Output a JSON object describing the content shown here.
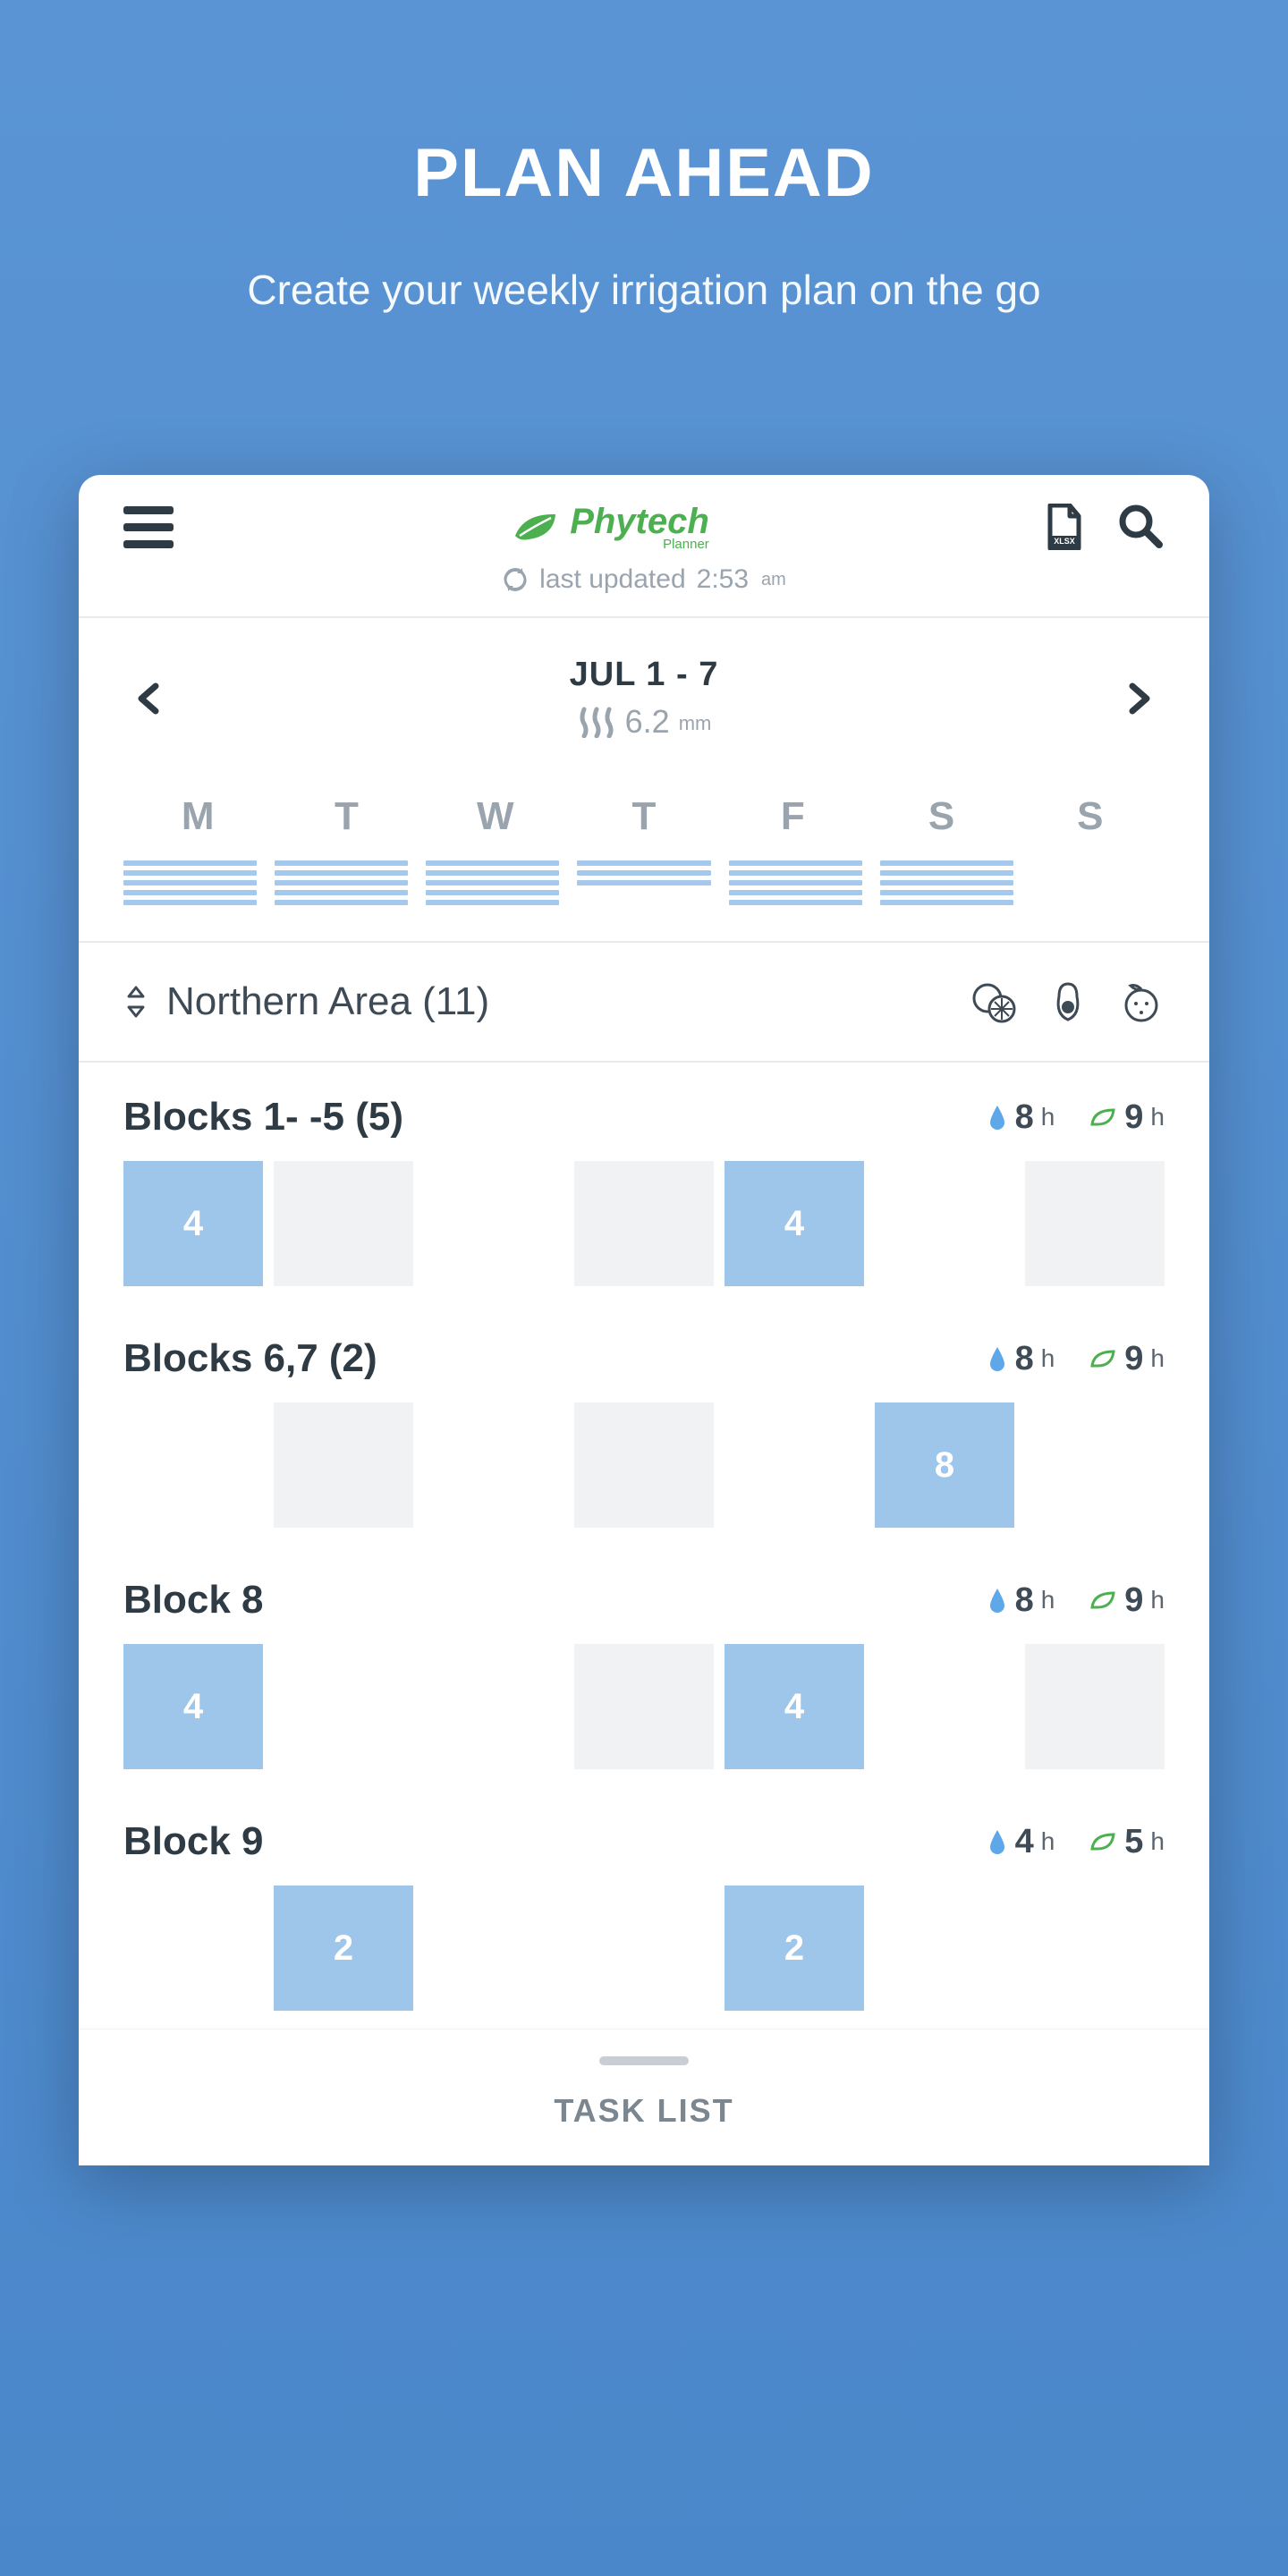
{
  "hero": {
    "title": "PLAN AHEAD",
    "subtitle": "Create your weekly irrigation plan on the go"
  },
  "app": {
    "brand": "Phytech",
    "brand_sub": "Planner",
    "last_updated_prefix": "last updated ",
    "last_updated_time": "2:53",
    "last_updated_ampm": "am",
    "xlsx_label": "XLSX"
  },
  "week": {
    "range": "JUL 1 - 7",
    "evap_value": "6.2",
    "evap_unit": "mm",
    "days": [
      "M",
      "T",
      "W",
      "T",
      "F",
      "S",
      "S"
    ]
  },
  "area": {
    "name": "Northern Area (11)",
    "crops": [
      "citrus",
      "avocado",
      "orange"
    ]
  },
  "blocks": [
    {
      "title": "Blocks 1- -5 (5)",
      "water_h": "8",
      "reco_h": "9",
      "cells": [
        {
          "type": "filled",
          "val": "4"
        },
        {
          "type": "empty"
        },
        {
          "type": "blank"
        },
        {
          "type": "empty"
        },
        {
          "type": "filled",
          "val": "4"
        },
        {
          "type": "blank"
        },
        {
          "type": "empty"
        }
      ]
    },
    {
      "title": "Blocks 6,7 (2)",
      "water_h": "8",
      "reco_h": "9",
      "cells": [
        {
          "type": "blank"
        },
        {
          "type": "empty"
        },
        {
          "type": "blank"
        },
        {
          "type": "empty"
        },
        {
          "type": "blank"
        },
        {
          "type": "filled",
          "val": "8"
        },
        {
          "type": "blank"
        }
      ]
    },
    {
      "title": "Block 8",
      "water_h": "8",
      "reco_h": "9",
      "cells": [
        {
          "type": "filled",
          "val": "4"
        },
        {
          "type": "blank"
        },
        {
          "type": "blank"
        },
        {
          "type": "empty"
        },
        {
          "type": "filled",
          "val": "4"
        },
        {
          "type": "blank"
        },
        {
          "type": "empty"
        }
      ]
    },
    {
      "title": "Block 9",
      "water_h": "4",
      "reco_h": "5",
      "cells": [
        {
          "type": "blank"
        },
        {
          "type": "filled",
          "val": "2"
        },
        {
          "type": "blank"
        },
        {
          "type": "blank"
        },
        {
          "type": "filled",
          "val": "2"
        },
        {
          "type": "blank"
        },
        {
          "type": "blank"
        }
      ]
    }
  ],
  "sheet": {
    "title": "TASK LIST"
  },
  "labels": {
    "h": "h"
  }
}
